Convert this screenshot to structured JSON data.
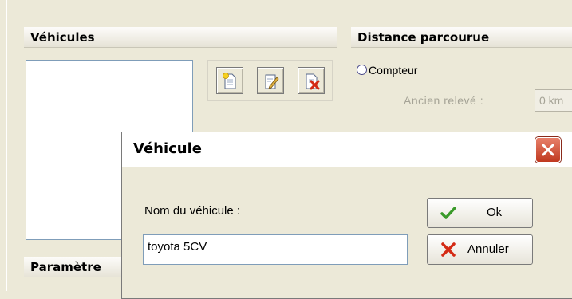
{
  "vehicles_section": {
    "title": "Véhicules"
  },
  "distance_section": {
    "title": "Distance parcourue"
  },
  "params_section": {
    "title": "Paramètre"
  },
  "vehicle_toolbar": {
    "new": "new-document-icon",
    "edit": "edit-icon",
    "delete": "delete-icon"
  },
  "counter_option": {
    "label": "Compteur",
    "selected": false
  },
  "previous_reading": {
    "label": "Ancien relevé :",
    "value": "0 km"
  },
  "dialog": {
    "title": "Véhicule",
    "name_label": "Nom du véhicule :",
    "name_value": "toyota 5CV",
    "ok_label": "Ok",
    "cancel_label": "Annuler"
  },
  "colors": {
    "window_bg": "#ece9d8",
    "close_button": "#c0391f",
    "ok_check": "#3a9a2a",
    "cancel_x": "#d42a14"
  }
}
